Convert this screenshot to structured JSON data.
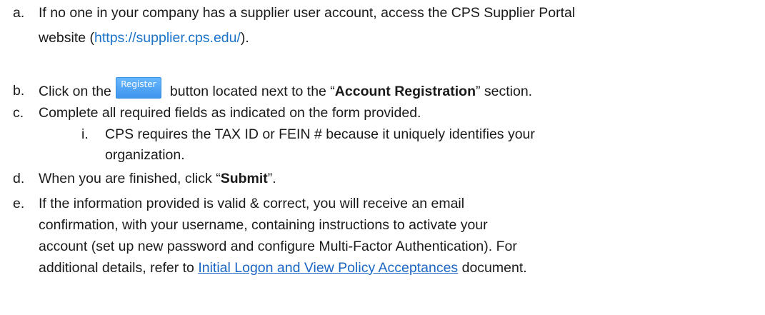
{
  "items": {
    "a": {
      "marker": "a.",
      "line1": "If no one in your company has a supplier user account, access the CPS Supplier Portal",
      "line2_pre": "website (",
      "link": "https://supplier.cps.edu/",
      "line2_post": ")."
    },
    "b": {
      "marker": "b.",
      "pre": "Click on the",
      "button_label": "Register",
      "mid": "button located next to the “",
      "bold": "Account Registration",
      "post": "” section."
    },
    "c": {
      "marker": "c.",
      "text": "Complete all required fields as indicated on the form provided."
    },
    "c_i": {
      "marker": "i.",
      "line1": "CPS requires the TAX ID or FEIN # because it uniquely identifies your",
      "line2": "organization."
    },
    "d": {
      "marker": "d.",
      "pre": "When you are finished, click “",
      "bold": "Submit",
      "post": "”."
    },
    "e": {
      "marker": "e.",
      "line1": "If the information provided is valid & correct, you will receive an email",
      "line2": "confirmation, with your username, containing instructions to activate your",
      "line3": "account (set up new password and configure Multi-Factor Authentication). For",
      "line4_pre": "additional details, refer to ",
      "link": "Initial Logon and View Policy Acceptances",
      "line4_post": " document."
    }
  },
  "colors": {
    "link": "#1a73c9",
    "button_bg": "#4fa3f5",
    "text": "#1a1a1a"
  }
}
